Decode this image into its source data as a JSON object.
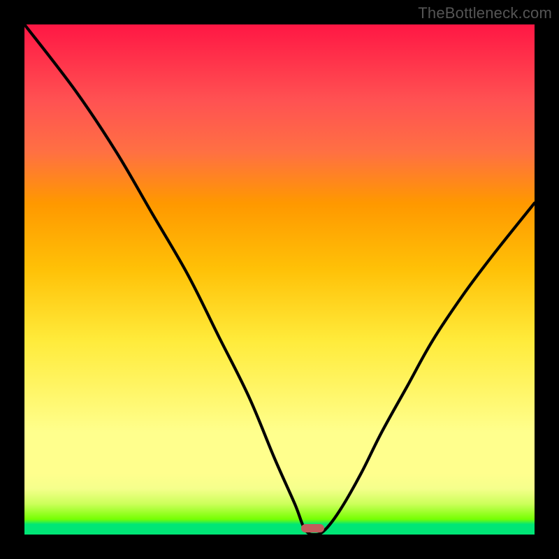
{
  "watermark": "TheBottleneck.com",
  "colors": {
    "frame": "#000000",
    "curve": "#000000",
    "marker": "#C25C5C",
    "gradient_top": "#FF1744",
    "gradient_bottom": "#00E676"
  },
  "chart_data": {
    "type": "line",
    "title": "",
    "xlabel": "",
    "ylabel": "",
    "xlim": [
      0,
      100
    ],
    "ylim": [
      0,
      100
    ],
    "grid": false,
    "series": [
      {
        "name": "bottleneck-curve",
        "x": [
          0,
          10,
          18,
          25,
          32,
          38,
          44,
          49,
          53,
          55,
          57,
          59,
          62,
          66,
          70,
          75,
          80,
          86,
          92,
          100
        ],
        "values": [
          100,
          87,
          75,
          63,
          51,
          39,
          27,
          15,
          6,
          1,
          0,
          1,
          5,
          12,
          20,
          29,
          38,
          47,
          55,
          65
        ]
      }
    ],
    "annotations": [
      {
        "name": "optimal-marker",
        "x_center": 56.5,
        "y": 0,
        "width_pct": 4.5,
        "height_pct": 1.6
      }
    ]
  }
}
